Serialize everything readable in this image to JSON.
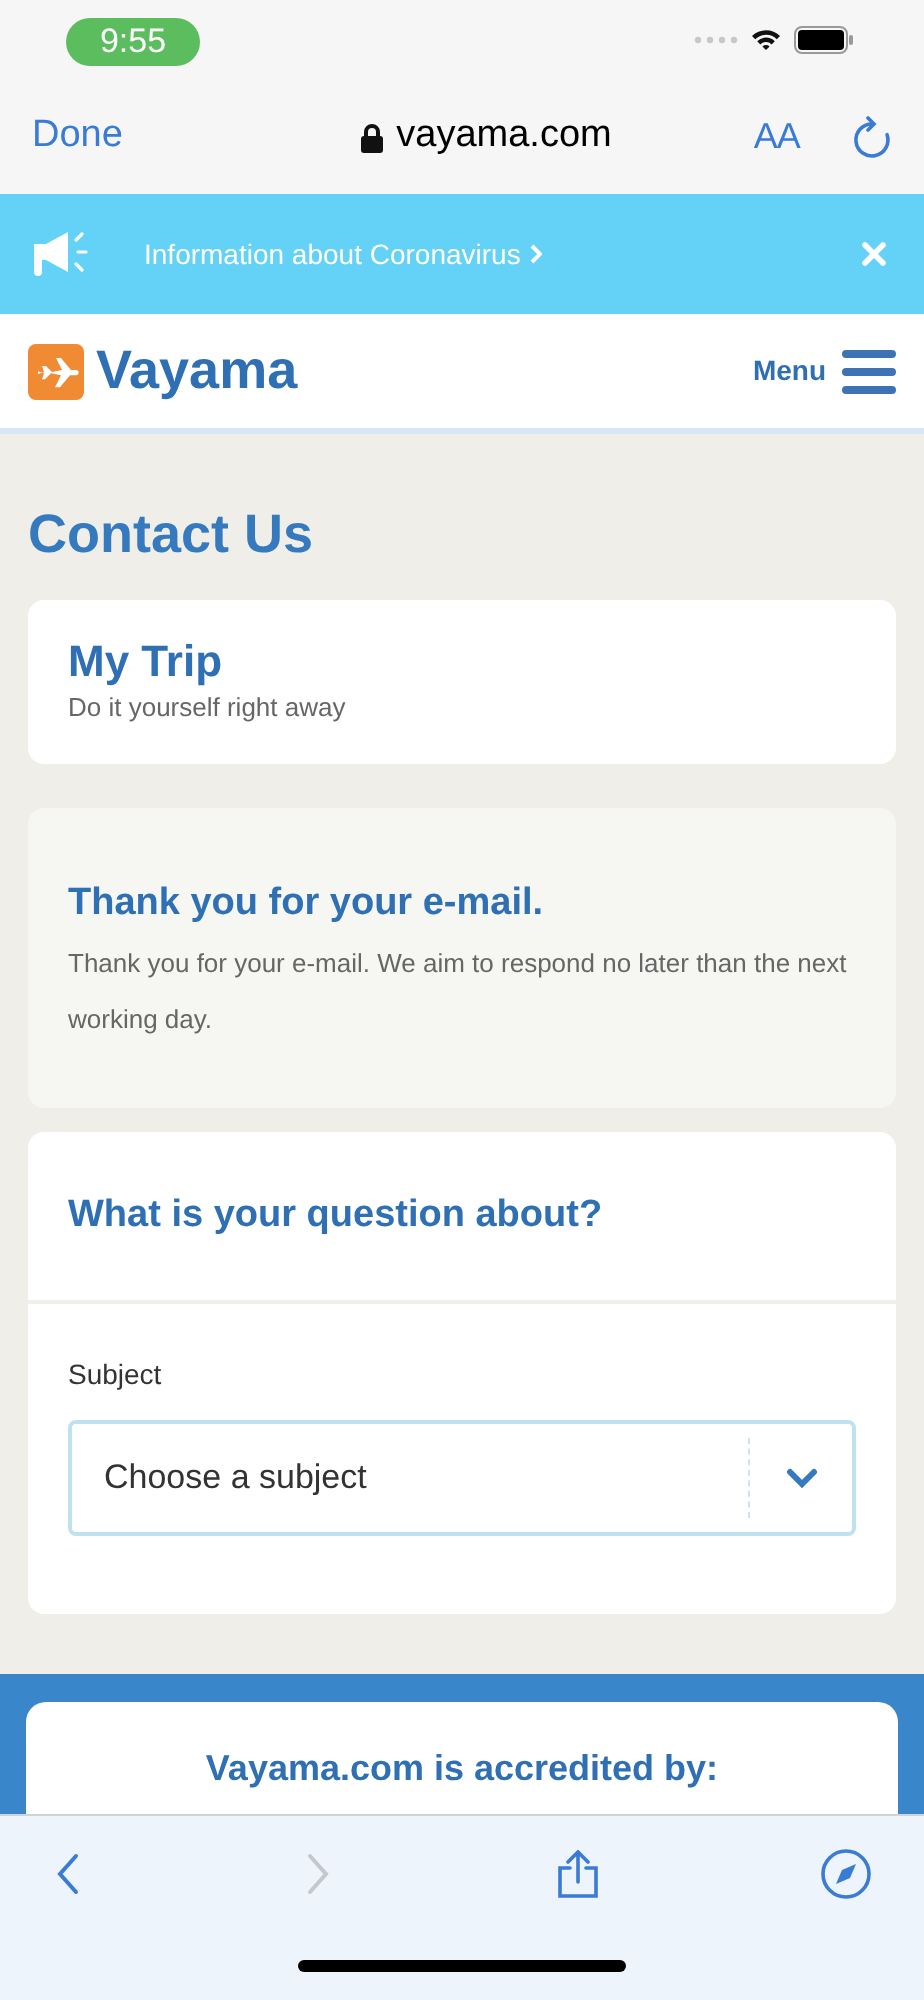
{
  "status_bar": {
    "time": "9:55"
  },
  "browser_bar": {
    "done": "Done",
    "url": "vayama.com",
    "text_size": "AA"
  },
  "banner": {
    "text": "Information about Coronavirus"
  },
  "header": {
    "logo": "Vayama",
    "menu": "Menu"
  },
  "page_title": "Contact Us",
  "my_trip": {
    "title": "My Trip",
    "subtitle": "Do it yourself right away"
  },
  "confirmation": {
    "title": "Thank you for your e-mail.",
    "text": "Thank you for your e-mail. We aim to respond no later than the next working day."
  },
  "question": {
    "title": "What is your question about?",
    "label": "Subject",
    "select": "Choose a subject"
  },
  "accredited": {
    "title": "Vayama.com is accredited by:"
  },
  "toolbar": [
    {
      "kind": "back",
      "disabled": false
    },
    {
      "kind": "forward",
      "disabled": true
    },
    {
      "kind": "share",
      "disabled": false
    },
    {
      "kind": "compass",
      "disabled": false
    }
  ]
}
